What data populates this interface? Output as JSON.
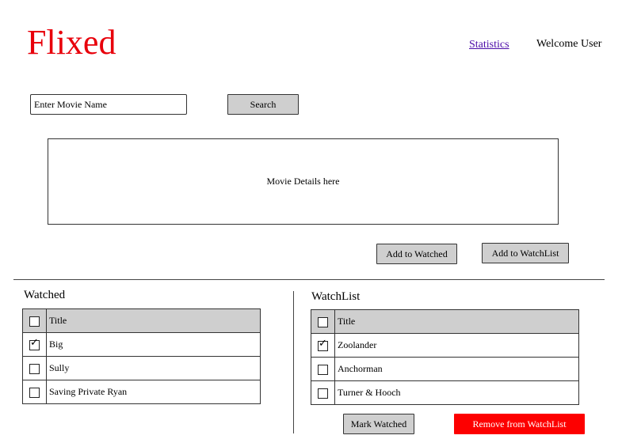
{
  "header": {
    "logo": "Flixed",
    "statistics_link": "Statistics",
    "welcome": "Welcome User"
  },
  "search": {
    "placeholder": "Enter Movie Name",
    "button_label": "Search"
  },
  "details": {
    "text": "Movie Details here"
  },
  "actions": {
    "add_watched": "Add to Watched",
    "add_watchlist": "Add to WatchList"
  },
  "watched": {
    "title": "Watched",
    "column_title": "Title",
    "rows": [
      {
        "title": "Big",
        "checked": true
      },
      {
        "title": "Sully",
        "checked": false
      },
      {
        "title": "Saving Private Ryan",
        "checked": false
      }
    ]
  },
  "watchlist": {
    "title": "WatchList",
    "column_title": "Title",
    "rows": [
      {
        "title": "Zoolander",
        "checked": true
      },
      {
        "title": "Anchorman",
        "checked": false
      },
      {
        "title": "Turner & Hooch",
        "checked": false
      }
    ],
    "mark_watched": "Mark Watched",
    "remove": "Remove from WatchList"
  },
  "colors": {
    "logo": "#e8000b",
    "link": "#4b0aa8",
    "button_bg": "#cfcfcf",
    "remove_bg": "#fd0000"
  }
}
